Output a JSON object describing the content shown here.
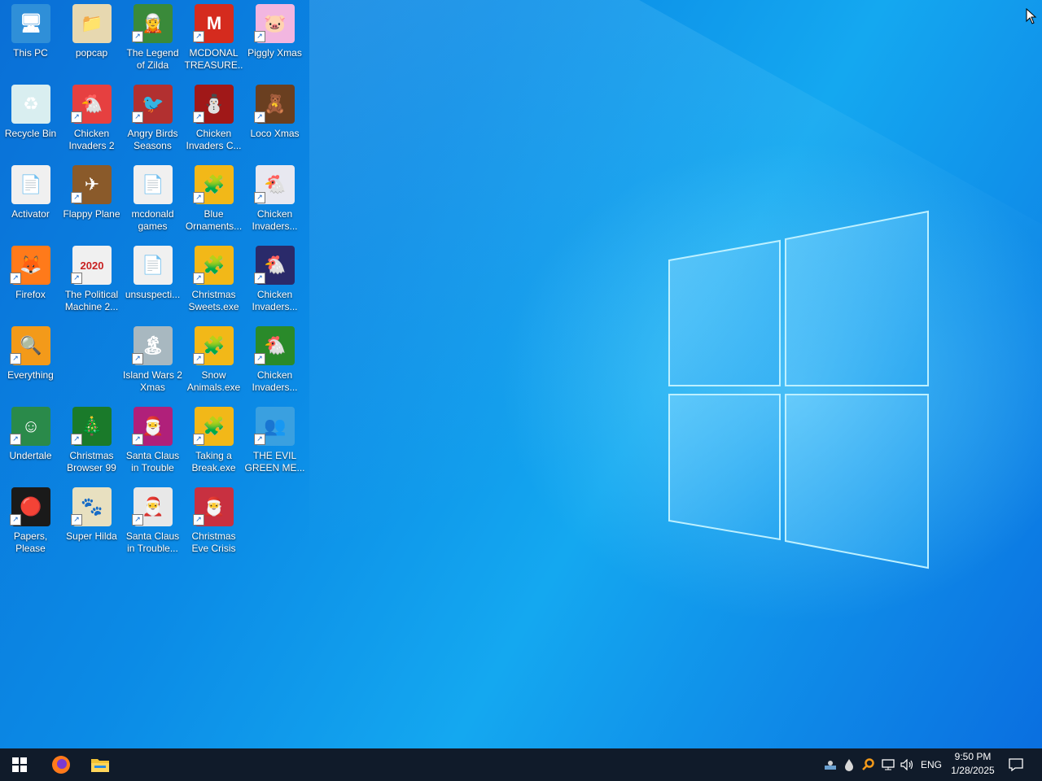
{
  "desktop": {
    "icons": [
      {
        "label": "This PC",
        "icon": "this-pc-icon",
        "color": "#2f8fd8",
        "glyph": "🖥",
        "shortcut": false
      },
      {
        "label": "popcap",
        "icon": "folder-icon",
        "color": "#e7d8b0",
        "glyph": "📁",
        "shortcut": false
      },
      {
        "label": "The Legend of Zilda",
        "icon": "zilda-game-icon",
        "color": "#3a8a3a",
        "glyph": "🧝",
        "shortcut": true
      },
      {
        "label": "MCDONAL TREASURE...",
        "icon": "mcdonald-icon",
        "color": "#d52b1e",
        "glyph": "M",
        "shortcut": true
      },
      {
        "label": "Piggly Xmas",
        "icon": "piggly-icon",
        "color": "#f2b6e0",
        "glyph": "🐷",
        "shortcut": true
      },
      {
        "label": "Recycle Bin",
        "icon": "recycle-bin-icon",
        "color": "#d9eef0",
        "glyph": "♻",
        "shortcut": false
      },
      {
        "label": "Chicken Invaders 2",
        "icon": "chicken-invaders-2-icon",
        "color": "#e64040",
        "glyph": "🐔",
        "shortcut": true
      },
      {
        "label": "Angry Birds Seasons",
        "icon": "angry-birds-icon",
        "color": "#b23030",
        "glyph": "🐦",
        "shortcut": true
      },
      {
        "label": "Chicken Invaders C...",
        "icon": "chicken-invaders-c-icon",
        "color": "#a01818",
        "glyph": "⛄",
        "shortcut": true
      },
      {
        "label": "Loco Xmas",
        "icon": "loco-xmas-icon",
        "color": "#6a3f20",
        "glyph": "🧸",
        "shortcut": true
      },
      {
        "label": "Activator",
        "icon": "folder-icon",
        "color": "#f0f0f0",
        "glyph": "📄",
        "shortcut": false
      },
      {
        "label": "Flappy Plane",
        "icon": "flappy-plane-icon",
        "color": "#8a5a2a",
        "glyph": "✈",
        "shortcut": true
      },
      {
        "label": "mcdonald games",
        "icon": "folder-icon",
        "color": "#f0f0f0",
        "glyph": "📄",
        "shortcut": false
      },
      {
        "label": "Blue Ornaments...",
        "icon": "puzzle-icon",
        "color": "#f2b818",
        "glyph": "🧩",
        "shortcut": true
      },
      {
        "label": "Chicken Invaders...",
        "icon": "chicken-invaders-icon",
        "color": "#e8e8f0",
        "glyph": "🐔",
        "shortcut": true
      },
      {
        "label": "Firefox",
        "icon": "firefox-icon",
        "color": "#ff7a1a",
        "glyph": "🦊",
        "shortcut": true
      },
      {
        "label": "The Political Machine 2...",
        "icon": "political-machine-icon",
        "color": "#f0f0f0",
        "glyph": "2020",
        "shortcut": true
      },
      {
        "label": "unsuspecti...",
        "icon": "folder-icon",
        "color": "#f0f0f0",
        "glyph": "📄",
        "shortcut": false
      },
      {
        "label": "Christmas Sweets.exe",
        "icon": "puzzle-icon",
        "color": "#f2b818",
        "glyph": "🧩",
        "shortcut": true
      },
      {
        "label": "Chicken Invaders...",
        "icon": "chicken-invaders-icon",
        "color": "#2a2a6a",
        "glyph": "🐔",
        "shortcut": true
      },
      {
        "label": "Everything",
        "icon": "everything-search-icon",
        "color": "#f39a1a",
        "glyph": "🔍",
        "shortcut": true
      },
      {
        "label": "",
        "icon": "",
        "color": "",
        "glyph": "",
        "shortcut": false,
        "empty": true
      },
      {
        "label": "Island Wars 2 Xmas",
        "icon": "island-wars-icon",
        "color": "#a8b8c0",
        "glyph": "🏝",
        "shortcut": true
      },
      {
        "label": "Snow Animals.exe",
        "icon": "puzzle-icon",
        "color": "#f2b818",
        "glyph": "🧩",
        "shortcut": true
      },
      {
        "label": "Chicken Invaders...",
        "icon": "chicken-invaders-icon",
        "color": "#2a8a2a",
        "glyph": "🐔",
        "shortcut": true
      },
      {
        "label": "Undertale",
        "icon": "undertale-icon",
        "color": "#2a8a4a",
        "glyph": "☺",
        "shortcut": true
      },
      {
        "label": "Christmas Browser 99",
        "icon": "christmas-tree-icon",
        "color": "#1a7a2a",
        "glyph": "🎄",
        "shortcut": true
      },
      {
        "label": "Santa Claus in Trouble",
        "icon": "santa-icon",
        "color": "#b0207a",
        "glyph": "🎅",
        "shortcut": true
      },
      {
        "label": "Taking a Break.exe",
        "icon": "puzzle-icon",
        "color": "#f2b818",
        "glyph": "🧩",
        "shortcut": true
      },
      {
        "label": "THE EVIL GREEN ME...",
        "icon": "messenger-icon",
        "color": "#3aa0e0",
        "glyph": "👥",
        "shortcut": true
      },
      {
        "label": "Papers, Please",
        "icon": "papers-please-icon",
        "color": "#1a1a1a",
        "glyph": "🔴",
        "shortcut": true
      },
      {
        "label": "Super Hilda",
        "icon": "super-hilda-icon",
        "color": "#e8e0c0",
        "glyph": "🐾",
        "shortcut": true
      },
      {
        "label": "Santa Claus in Trouble...",
        "icon": "santa-icon",
        "color": "#e8e8e8",
        "glyph": "🎅",
        "shortcut": true
      },
      {
        "label": "Christmas Eve Crisis",
        "icon": "santa-crisis-icon",
        "color": "#c83040",
        "glyph": "🎅",
        "shortcut": true
      }
    ]
  },
  "taskbar": {
    "start_icon": "windows-start-icon",
    "pinned": [
      {
        "name": "firefox-taskbar-icon",
        "glyph": "🦊"
      },
      {
        "name": "file-explorer-icon",
        "glyph": "📁"
      }
    ],
    "tray_icons": [
      "network-user-icon",
      "water-drop-icon",
      "everything-tray-icon",
      "network-icon",
      "volume-icon"
    ],
    "language": "ENG",
    "time": "9:50 PM",
    "date": "1/28/2025",
    "notification_icon": "notification-center-icon"
  },
  "colors": {
    "taskbar_bg": "#101b2a",
    "desktop_blue": "#0b8be6",
    "label_text": "#ffffff"
  }
}
